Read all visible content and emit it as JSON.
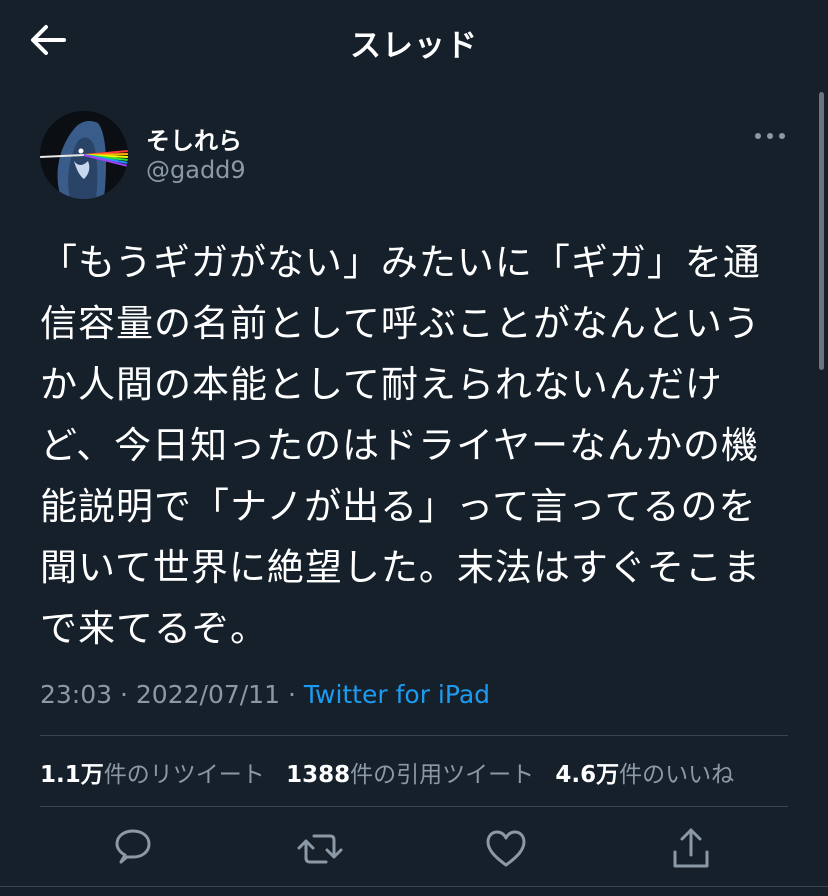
{
  "header": {
    "title": "スレッド",
    "back_icon": "arrow-left-icon"
  },
  "author": {
    "display_name": "そしれら",
    "handle": "@gadd9",
    "avatar_icon": "avatar-prism-icon",
    "more_icon": "more-horizontal-icon"
  },
  "tweet": {
    "text": "「もうギガがない」みたいに「ギガ」を通\n信容量の名前として呼ぶことがなんという\nか人間の本能として耐えられないんだけ\nど、今日知ったのはドライヤーなんかの機\n能説明で「ナノが出る」って言ってるのを\n聞いて世界に絶望した。末法はすぐそこま\nで来てるぞ。",
    "time": "23:03",
    "sep": "·",
    "date": "2022/07/11",
    "source": "Twitter for iPad"
  },
  "stats": {
    "retweets_value": "1.1万",
    "retweets_label": "件のリツイート",
    "quotes_value": "1388",
    "quotes_label": "件の引用ツイート",
    "likes_value": "4.6万",
    "likes_label": "件のいいね"
  },
  "actions": {
    "reply_icon": "reply-icon",
    "retweet_icon": "retweet-icon",
    "like_icon": "heart-icon",
    "share_icon": "share-icon"
  },
  "colors": {
    "background": "#15202b",
    "text": "#ffffff",
    "secondary": "#8b98a5",
    "accent": "#1d9bf0",
    "border": "#38444d"
  }
}
